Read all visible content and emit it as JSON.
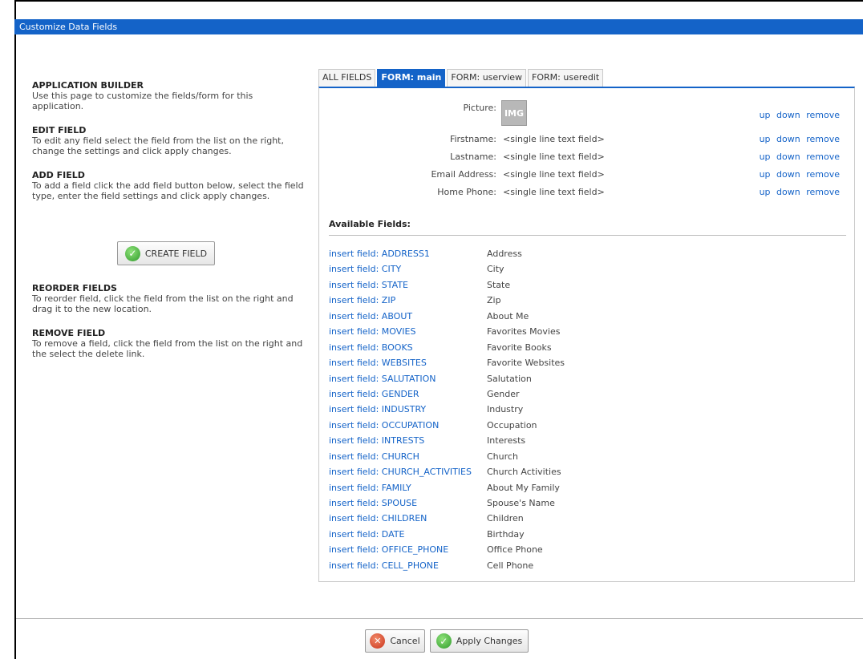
{
  "window": {
    "title": "Customize Data Fields"
  },
  "help": [
    {
      "heading": "APPLICATION BUILDER",
      "text": "Use this page to customize the fields/form for this application."
    },
    {
      "heading": "EDIT FIELD",
      "text": "To edit any field select the field from the list on the right, change the settings and click apply changes."
    },
    {
      "heading": "ADD FIELD",
      "text": "To add a field click the add field button below, select the field type, enter the field settings and click apply changes."
    },
    {
      "heading": "REORDER FIELDS",
      "text": "To reorder field, click the field from the list on the right and drag it to the new location."
    },
    {
      "heading": "REMOVE FIELD",
      "text": "To remove a field, click the field from the list on the right and the select the delete link."
    }
  ],
  "create_button": {
    "label": "CREATE FIELD",
    "icon": "check-icon"
  },
  "tabs": [
    {
      "label": "ALL FIELDS",
      "active": false
    },
    {
      "label": "FORM: main",
      "active": true
    },
    {
      "label": "FORM: userview",
      "active": false
    },
    {
      "label": "FORM: useredit",
      "active": false
    }
  ],
  "form_fields": [
    {
      "label": "Picture:",
      "value": "IMG",
      "kind": "image"
    },
    {
      "label": "Firstname:",
      "value": "<single line text field>",
      "kind": "text"
    },
    {
      "label": "Lastname:",
      "value": "<single line text field>",
      "kind": "text"
    },
    {
      "label": "Email Address:",
      "value": "<single line text field>",
      "kind": "text"
    },
    {
      "label": "Home Phone:",
      "value": "<single line text field>",
      "kind": "text"
    }
  ],
  "field_actions": {
    "up": "up",
    "down": "down",
    "remove": "remove"
  },
  "available": {
    "title": "Available Fields:",
    "items": [
      {
        "link": "insert field: ADDRESS1",
        "name": "Address"
      },
      {
        "link": "insert field: CITY",
        "name": "City"
      },
      {
        "link": "insert field: STATE",
        "name": "State"
      },
      {
        "link": "insert field: ZIP",
        "name": "Zip"
      },
      {
        "link": "insert field: ABOUT",
        "name": "About Me"
      },
      {
        "link": "insert field: MOVIES",
        "name": "Favorites Movies"
      },
      {
        "link": "insert field: BOOKS",
        "name": "Favorite Books"
      },
      {
        "link": "insert field: WEBSITES",
        "name": "Favorite Websites"
      },
      {
        "link": "insert field: SALUTATION",
        "name": "Salutation"
      },
      {
        "link": "insert field: GENDER",
        "name": "Gender"
      },
      {
        "link": "insert field: INDUSTRY",
        "name": "Industry"
      },
      {
        "link": "insert field: OCCUPATION",
        "name": "Occupation"
      },
      {
        "link": "insert field: INTRESTS",
        "name": "Interests"
      },
      {
        "link": "insert field: CHURCH",
        "name": "Church"
      },
      {
        "link": "insert field: CHURCH_ACTIVITIES",
        "name": "Church Activities"
      },
      {
        "link": "insert field: FAMILY",
        "name": "About My Family"
      },
      {
        "link": "insert field: SPOUSE",
        "name": "Spouse's Name"
      },
      {
        "link": "insert field: CHILDREN",
        "name": "Children"
      },
      {
        "link": "insert field: DATE",
        "name": "Birthday"
      },
      {
        "link": "insert field: OFFICE_PHONE",
        "name": "Office Phone"
      },
      {
        "link": "insert field: CELL_PHONE",
        "name": "Cell Phone"
      }
    ]
  },
  "footer": {
    "cancel": {
      "label": "Cancel",
      "icon": "x-icon"
    },
    "apply": {
      "label": "Apply Changes",
      "icon": "check-icon"
    }
  },
  "colors": {
    "accent": "#1463c8",
    "link": "#1463c8"
  }
}
